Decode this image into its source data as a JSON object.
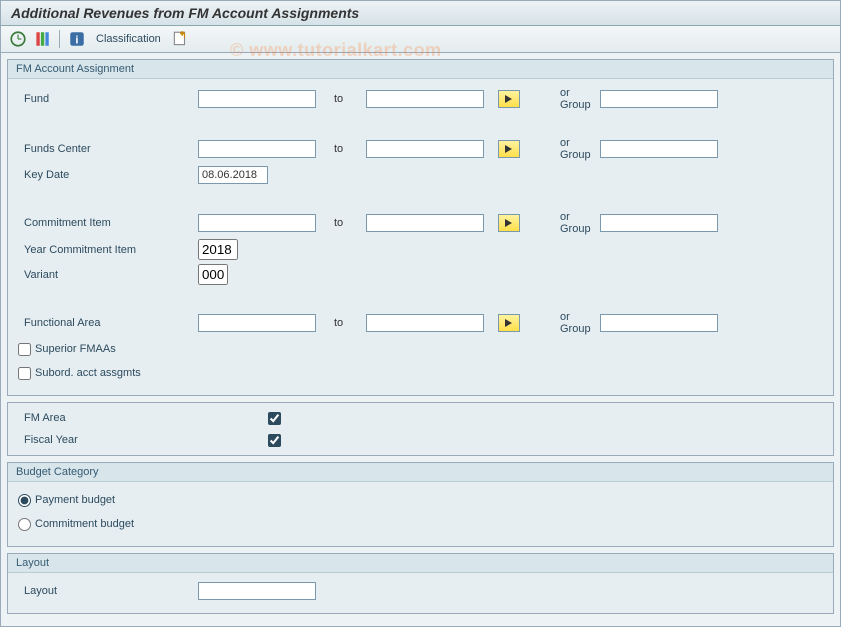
{
  "title": "Additional Revenues from FM Account Assignments",
  "watermark": "© www.tutorialkart.com",
  "toolbar": {
    "classification": "Classification"
  },
  "fm": {
    "header": "FM Account Assignment",
    "fund_lbl": "Fund",
    "fund_from": "",
    "fund_to": "",
    "fund_group": "",
    "funds_center_lbl": "Funds Center",
    "fc_from": "",
    "fc_to": "",
    "fc_group": "",
    "key_date_lbl": "Key Date",
    "key_date": "08.06.2018",
    "commit_item_lbl": "Commitment Item",
    "ci_from": "",
    "ci_to": "",
    "ci_group": "",
    "year_ci_lbl": "Year Commitment Item",
    "year_ci": "2018",
    "variant_lbl": "Variant",
    "variant": "000",
    "func_area_lbl": "Functional Area",
    "fa_from": "",
    "fa_to": "",
    "fa_group": "",
    "to_lbl": "to",
    "orgroup_lbl": "or Group",
    "superior_lbl": "Superior FMAAs",
    "subord_lbl": "Subord. acct assgmts"
  },
  "flat": {
    "fm_area_lbl": "FM Area",
    "fiscal_year_lbl": "Fiscal Year"
  },
  "budget": {
    "header": "Budget Category",
    "payment_lbl": "Payment budget",
    "commitment_lbl": "Commitment budget"
  },
  "layout": {
    "header": "Layout",
    "layout_lbl": "Layout",
    "layout_val": ""
  }
}
